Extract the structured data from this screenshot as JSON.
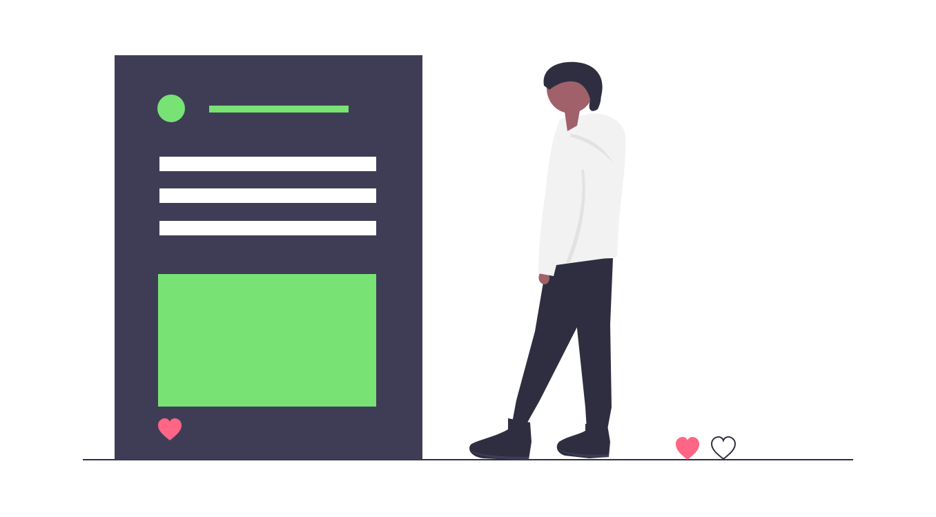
{
  "illustration": {
    "subject": "social-media-post-with-person",
    "colors": {
      "background": "#ffffff",
      "panel": "#3f3d56",
      "accent_green": "#78e374",
      "text_bar": "#ffffff",
      "heart_filled": "#ff6584",
      "heart_outline": "#2f2e41",
      "ground_line": "#2f2e41",
      "skin": "#a0616a",
      "hair": "#2f2e41",
      "hoodie": "#f2f2f2",
      "hoodie_shade": "#e2e2e2",
      "pants": "#2f2e41",
      "shoes": "#2f2e41"
    },
    "icons": {
      "post_like": "heart-filled-icon",
      "floor_like": "heart-filled-icon",
      "floor_unlike": "heart-outline-icon"
    }
  }
}
